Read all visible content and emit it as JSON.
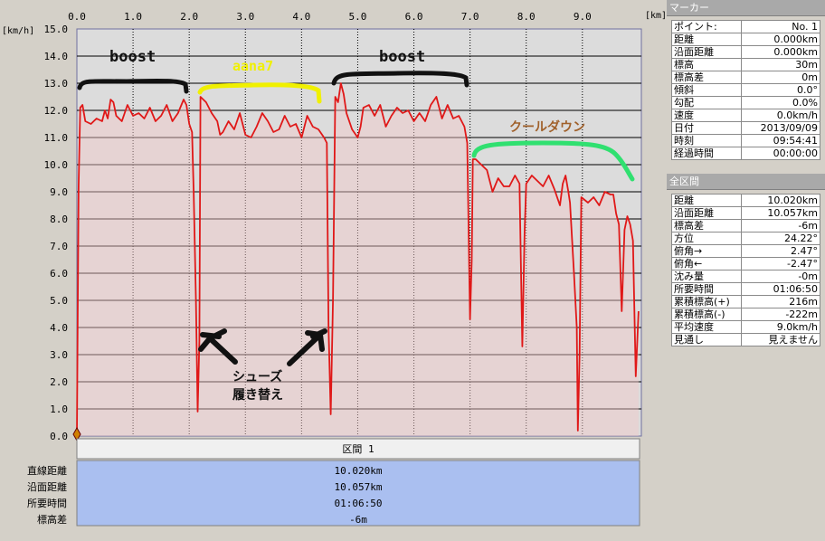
{
  "chart_data": {
    "type": "line",
    "xlabel": "[km]",
    "ylabel": "[km/h]",
    "xlim": [
      0,
      10.05
    ],
    "ylim": [
      0,
      15
    ],
    "x_ticks": [
      "0.0",
      "1.0",
      "2.0",
      "3.0",
      "4.0",
      "5.0",
      "6.0",
      "7.0",
      "8.0",
      "9.0"
    ],
    "y_ticks": [
      "0.0",
      "1.0",
      "2.0",
      "3.0",
      "4.0",
      "5.0",
      "6.0",
      "7.0",
      "8.0",
      "9.0",
      "10.0",
      "11.0",
      "12.0",
      "13.0",
      "14.0",
      "15.0"
    ],
    "series": [
      {
        "color": "#e01818",
        "points": [
          [
            0.0,
            0.0
          ],
          [
            0.03,
            9.2
          ],
          [
            0.06,
            12.1
          ],
          [
            0.1,
            12.2
          ],
          [
            0.15,
            11.6
          ],
          [
            0.25,
            11.5
          ],
          [
            0.35,
            11.7
          ],
          [
            0.45,
            11.6
          ],
          [
            0.5,
            12.0
          ],
          [
            0.55,
            11.7
          ],
          [
            0.6,
            12.4
          ],
          [
            0.65,
            12.3
          ],
          [
            0.7,
            11.8
          ],
          [
            0.8,
            11.6
          ],
          [
            0.9,
            12.2
          ],
          [
            1.0,
            11.8
          ],
          [
            1.1,
            11.9
          ],
          [
            1.2,
            11.7
          ],
          [
            1.3,
            12.1
          ],
          [
            1.4,
            11.6
          ],
          [
            1.5,
            11.8
          ],
          [
            1.6,
            12.2
          ],
          [
            1.7,
            11.6
          ],
          [
            1.8,
            11.9
          ],
          [
            1.9,
            12.4
          ],
          [
            1.95,
            12.2
          ],
          [
            2.0,
            11.5
          ],
          [
            2.05,
            11.2
          ],
          [
            2.08,
            9.0
          ],
          [
            2.12,
            5.0
          ],
          [
            2.15,
            0.9
          ],
          [
            2.18,
            3.5
          ],
          [
            2.2,
            12.5
          ],
          [
            2.25,
            12.4
          ],
          [
            2.3,
            12.3
          ],
          [
            2.4,
            11.9
          ],
          [
            2.5,
            11.6
          ],
          [
            2.55,
            11.1
          ],
          [
            2.6,
            11.2
          ],
          [
            2.7,
            11.6
          ],
          [
            2.8,
            11.3
          ],
          [
            2.9,
            11.9
          ],
          [
            3.0,
            11.1
          ],
          [
            3.1,
            11.0
          ],
          [
            3.2,
            11.4
          ],
          [
            3.3,
            11.9
          ],
          [
            3.4,
            11.6
          ],
          [
            3.5,
            11.2
          ],
          [
            3.6,
            11.3
          ],
          [
            3.7,
            11.8
          ],
          [
            3.8,
            11.4
          ],
          [
            3.9,
            11.5
          ],
          [
            4.0,
            11.0
          ],
          [
            4.1,
            11.8
          ],
          [
            4.2,
            11.4
          ],
          [
            4.3,
            11.3
          ],
          [
            4.4,
            11.0
          ],
          [
            4.45,
            10.8
          ],
          [
            4.48,
            4.0
          ],
          [
            4.52,
            0.8
          ],
          [
            4.56,
            5.0
          ],
          [
            4.6,
            12.5
          ],
          [
            4.65,
            12.3
          ],
          [
            4.7,
            13.0
          ],
          [
            4.75,
            12.6
          ],
          [
            4.8,
            11.9
          ],
          [
            4.9,
            11.3
          ],
          [
            5.0,
            11.0
          ],
          [
            5.05,
            11.4
          ],
          [
            5.1,
            12.1
          ],
          [
            5.2,
            12.2
          ],
          [
            5.3,
            11.8
          ],
          [
            5.4,
            12.2
          ],
          [
            5.5,
            11.4
          ],
          [
            5.6,
            11.8
          ],
          [
            5.7,
            12.1
          ],
          [
            5.8,
            11.9
          ],
          [
            5.9,
            12.0
          ],
          [
            6.0,
            11.6
          ],
          [
            6.1,
            11.9
          ],
          [
            6.2,
            11.6
          ],
          [
            6.3,
            12.2
          ],
          [
            6.4,
            12.5
          ],
          [
            6.5,
            11.7
          ],
          [
            6.6,
            12.2
          ],
          [
            6.7,
            11.7
          ],
          [
            6.8,
            11.8
          ],
          [
            6.9,
            11.4
          ],
          [
            6.95,
            10.8
          ],
          [
            7.0,
            4.3
          ],
          [
            7.03,
            6.5
          ],
          [
            7.05,
            10.2
          ],
          [
            7.1,
            10.2
          ],
          [
            7.2,
            10.0
          ],
          [
            7.3,
            9.8
          ],
          [
            7.4,
            9.0
          ],
          [
            7.5,
            9.5
          ],
          [
            7.6,
            9.2
          ],
          [
            7.7,
            9.2
          ],
          [
            7.8,
            9.6
          ],
          [
            7.88,
            9.3
          ],
          [
            7.93,
            3.3
          ],
          [
            7.97,
            7.5
          ],
          [
            8.0,
            9.3
          ],
          [
            8.1,
            9.6
          ],
          [
            8.2,
            9.4
          ],
          [
            8.3,
            9.2
          ],
          [
            8.4,
            9.6
          ],
          [
            8.5,
            9.1
          ],
          [
            8.6,
            8.5
          ],
          [
            8.65,
            9.3
          ],
          [
            8.7,
            9.6
          ],
          [
            8.75,
            9.0
          ],
          [
            8.78,
            8.6
          ],
          [
            8.85,
            6.0
          ],
          [
            8.9,
            4.0
          ],
          [
            8.92,
            0.2
          ],
          [
            8.95,
            3.0
          ],
          [
            8.98,
            8.8
          ],
          [
            9.1,
            8.6
          ],
          [
            9.2,
            8.8
          ],
          [
            9.3,
            8.5
          ],
          [
            9.4,
            9.0
          ],
          [
            9.5,
            8.9
          ],
          [
            9.55,
            8.9
          ],
          [
            9.6,
            8.2
          ],
          [
            9.65,
            7.8
          ],
          [
            9.7,
            4.6
          ],
          [
            9.75,
            7.6
          ],
          [
            9.8,
            8.1
          ],
          [
            9.85,
            7.8
          ],
          [
            9.9,
            7.2
          ],
          [
            9.95,
            2.2
          ],
          [
            10.0,
            4.6
          ]
        ]
      }
    ],
    "annotations": {
      "boost1": "boost",
      "aana7": "aana7",
      "boost2": "boost",
      "cooldown": "クールダウン",
      "shoes_line1": "シューズ",
      "shoes_line2": "履き替え"
    }
  },
  "section_header": "区間 1",
  "summary": [
    {
      "label": "直線距離",
      "value": "10.020km"
    },
    {
      "label": "沿面距離",
      "value": "10.057km"
    },
    {
      "label": "所要時間",
      "value": "01:06:50"
    },
    {
      "label": "標高差",
      "value": "-6m"
    }
  ],
  "marker_panel": {
    "title": "マーカー",
    "rows": [
      {
        "label": "ポイント:",
        "value": "No. 1"
      },
      {
        "label": "距離",
        "value": "0.000km"
      },
      {
        "label": "沿面距離",
        "value": "0.000km"
      },
      {
        "label": "標高",
        "value": "30m"
      },
      {
        "label": "標高差",
        "value": "0m"
      },
      {
        "label": "傾斜",
        "value": "0.0°"
      },
      {
        "label": "勾配",
        "value": "0.0%"
      },
      {
        "label": "速度",
        "value": "0.0km/h"
      },
      {
        "label": "日付",
        "value": "2013/09/09"
      },
      {
        "label": "時刻",
        "value": "09:54:41"
      },
      {
        "label": "経過時間",
        "value": "00:00:00"
      }
    ]
  },
  "section_panel": {
    "title": "全区間",
    "rows": [
      {
        "label": "距離",
        "value": "10.020km"
      },
      {
        "label": "沿面距離",
        "value": "10.057km"
      },
      {
        "label": "標高差",
        "value": "-6m"
      },
      {
        "label": "方位",
        "value": "24.22°"
      },
      {
        "label": "俯角→",
        "value": "2.47°"
      },
      {
        "label": "俯角←",
        "value": "-2.47°"
      },
      {
        "label": "沈み量",
        "value": "-0m"
      },
      {
        "label": "所要時間",
        "value": "01:06:50"
      },
      {
        "label": "累積標高(+)",
        "value": "216m"
      },
      {
        "label": "累積標高(-)",
        "value": "-222m"
      },
      {
        "label": "平均速度",
        "value": "9.0km/h"
      },
      {
        "label": "見通し",
        "value": "見えません"
      }
    ]
  }
}
